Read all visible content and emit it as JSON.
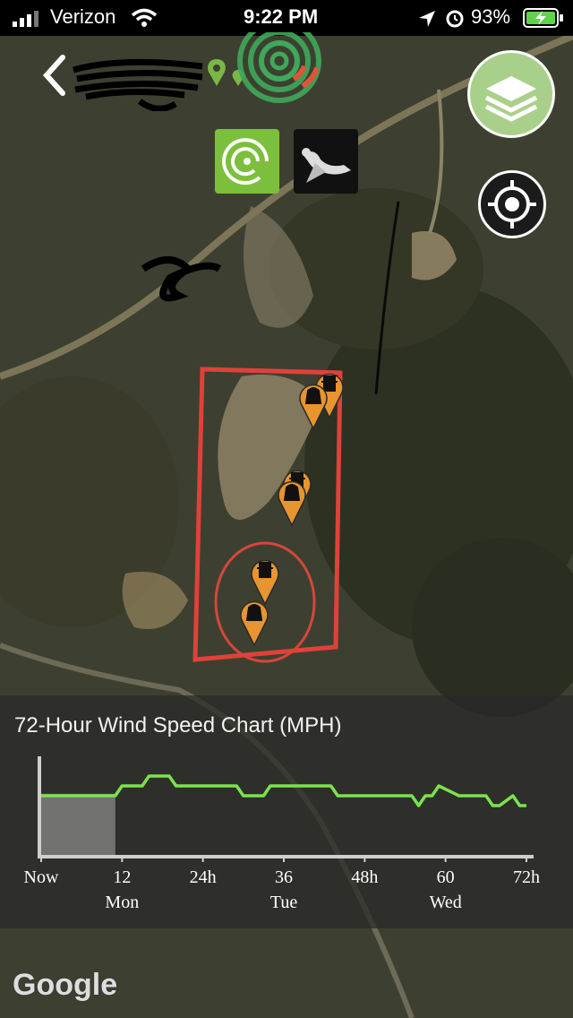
{
  "status_bar": {
    "carrier": "Verizon",
    "time": "9:22 PM",
    "battery": "93%"
  },
  "header": {
    "back_icon": "chevron-left-icon",
    "title_redacted": true
  },
  "toolbar": {
    "layers_icon": "layers-icon",
    "locate_icon": "crosshair-icon",
    "app_icon": "radar-rings-icon",
    "bird_icon": "goose-icon"
  },
  "map": {
    "boundary_color": "#e0413a",
    "marker_color": "#e89530",
    "markers": [
      "stand-icon",
      "blind-icon",
      "stand-icon",
      "blind-icon",
      "stand-icon",
      "blind-icon"
    ]
  },
  "chart_data": {
    "type": "line",
    "title": "72-Hour Wind Speed Chart (MPH)",
    "color": "#7be34d",
    "x_tick_labels": [
      "Now",
      "12",
      "24h",
      "36",
      "48h",
      "60",
      "72h"
    ],
    "x_ticks": [
      0,
      12,
      24,
      36,
      48,
      60,
      72
    ],
    "day_labels": [
      {
        "x": 12,
        "label": "Mon"
      },
      {
        "x": 36,
        "label": "Tue"
      },
      {
        "x": 60,
        "label": "Wed"
      }
    ],
    "xlim": [
      0,
      72
    ],
    "ylim": [
      0,
      10
    ],
    "shaded_range": [
      0,
      11
    ],
    "x": [
      0,
      11,
      12,
      15,
      16,
      19,
      20,
      24,
      29,
      30,
      33,
      34,
      43,
      44,
      55,
      56,
      57,
      58,
      59,
      62,
      63,
      64,
      66,
      67,
      68,
      70,
      71,
      72
    ],
    "y": [
      6,
      6,
      7,
      7,
      8,
      8,
      7,
      7,
      7,
      6,
      6,
      7,
      7,
      6,
      6,
      5,
      6,
      6,
      7,
      6,
      6,
      6,
      6,
      5,
      5,
      6,
      5,
      5
    ]
  },
  "footer": {
    "watermark": "Google"
  }
}
